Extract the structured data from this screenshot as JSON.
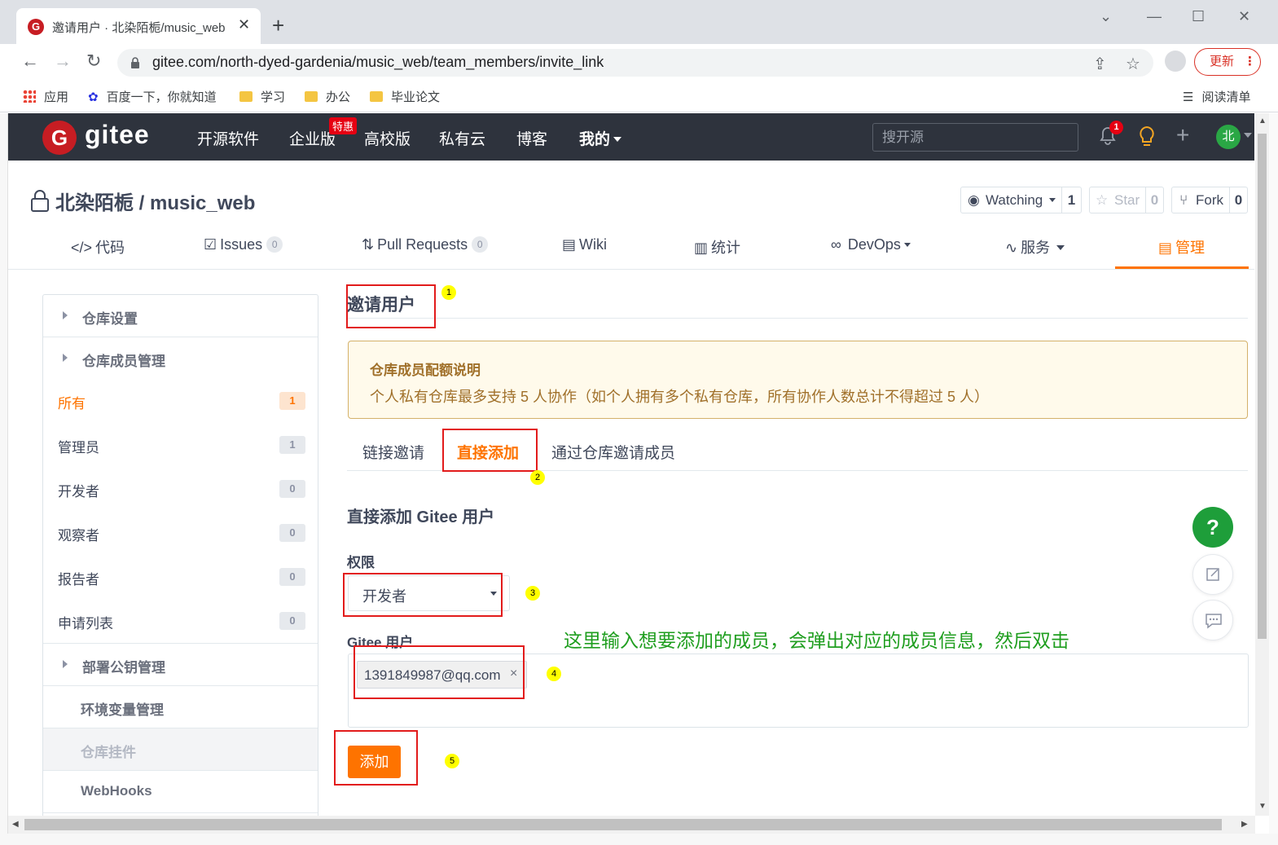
{
  "browser": {
    "tab_title": "邀请用户 · 北染陌栀/music_web",
    "tab_close": "✕",
    "new_tab": "+",
    "url": "gitee.com/north-dyed-gardenia/music_web/team_members/invite_link",
    "update_label": "更新",
    "bookmarks": [
      "应用",
      "百度一下，你就知道",
      "学习",
      "办公",
      "毕业论文"
    ],
    "reading_list": "阅读清单"
  },
  "gitee": {
    "logo_text": "gitee",
    "logo_letter": "G",
    "nav": [
      "开源软件",
      "企业版",
      "高校版",
      "私有云",
      "博客",
      "我的"
    ],
    "hot_badge": "特惠",
    "search_placeholder": "搜开源",
    "notification_count": "1",
    "avatar_letter": "北"
  },
  "repo": {
    "title": "北染陌栀 / music_web",
    "watch_label": "Watching",
    "watch_count": "1",
    "star_label": "Star",
    "star_count": "0",
    "fork_label": "Fork",
    "fork_count": "0",
    "tabs": {
      "code": "代码",
      "issues": "Issues",
      "issues_count": "0",
      "pr": "Pull Requests",
      "pr_count": "0",
      "wiki": "Wiki",
      "stats": "统计",
      "devops": "DevOps",
      "services": "服务",
      "manage": "管理"
    }
  },
  "sidebar": {
    "repo_settings": "仓库设置",
    "member_mgmt": "仓库成员管理",
    "members": [
      {
        "label": "所有",
        "count": "1"
      },
      {
        "label": "管理员",
        "count": "1"
      },
      {
        "label": "开发者",
        "count": "0"
      },
      {
        "label": "观察者",
        "count": "0"
      },
      {
        "label": "报告者",
        "count": "0"
      },
      {
        "label": "申请列表",
        "count": "0"
      }
    ],
    "deploy_keys": "部署公钥管理",
    "env_vars": "环境变量管理",
    "widgets": "仓库挂件",
    "webhooks": "WebHooks"
  },
  "main": {
    "title": "邀请用户",
    "notice_title": "仓库成员配额说明",
    "notice_body": "个人私有仓库最多支持 5 人协作（如个人拥有多个私有仓库，所有协作人数总计不得超过 5 人）",
    "invite_tabs": [
      "链接邀请",
      "直接添加",
      "通过仓库邀请成员"
    ],
    "section_title": "直接添加 Gitee 用户",
    "permission_label": "权限",
    "permission_value": "开发者",
    "user_label": "Gitee 用户",
    "user_tag": "1391849987@qq.com",
    "tag_remove": "×",
    "add_button": "添加"
  },
  "annotations": {
    "markers": [
      "1",
      "2",
      "3",
      "4",
      "5"
    ],
    "note": "这里输入想要添加的成员，会弹出对应的成员信息，然后双击"
  },
  "floating": {
    "help": "?"
  },
  "colors": {
    "accent": "#fe7300",
    "header_bg": "#2e333d",
    "brand_red": "#c71d23",
    "annotation_red": "#e21b1b",
    "annotation_green": "#1f9e1f"
  }
}
